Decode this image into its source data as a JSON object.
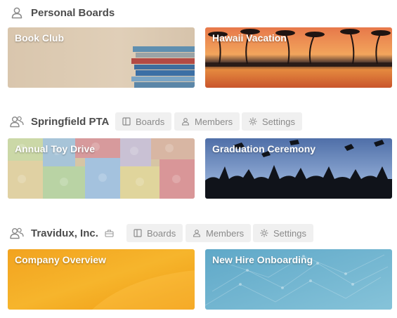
{
  "personal": {
    "title": "Personal Boards",
    "icon": "user-icon",
    "boards": [
      {
        "title": "Book Club"
      },
      {
        "title": "Hawaii Vacation"
      }
    ]
  },
  "springfield": {
    "title": "Springfield PTA",
    "icon": "team-icon",
    "tabs": {
      "boards": "Boards",
      "members": "Members",
      "settings": "Settings"
    },
    "boards": [
      {
        "title": "Annual Toy Drive"
      },
      {
        "title": "Graduation Ceremony"
      }
    ]
  },
  "travidux": {
    "title": "Travidux, Inc.",
    "icon": "team-icon",
    "badge_icon": "business-class-icon",
    "tabs": {
      "boards": "Boards",
      "members": "Members",
      "settings": "Settings"
    },
    "boards": [
      {
        "title": "Company Overview"
      },
      {
        "title": "New Hire Onboarding"
      }
    ]
  },
  "colors": {
    "tab_bg": "#f0f0f0",
    "tab_text": "#8a8a8a",
    "section_title": "#4d4d4d"
  }
}
